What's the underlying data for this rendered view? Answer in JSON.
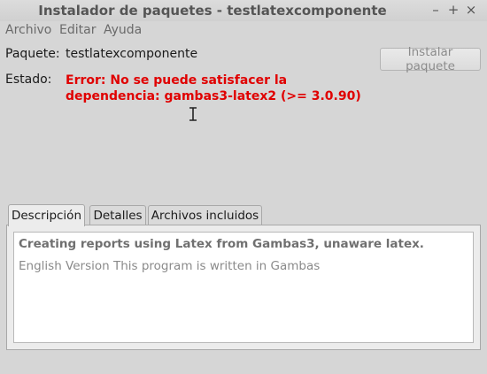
{
  "window": {
    "title": "Instalador de paquetes - testlatexcomponente",
    "controls": {
      "minimize": "–",
      "maximize": "+",
      "close": "×"
    }
  },
  "menu": {
    "items": [
      "Archivo",
      "Editar",
      "Ayuda"
    ]
  },
  "package": {
    "label": "Paquete:",
    "name": "testlatexcomponente"
  },
  "status": {
    "label": "Estado:",
    "line1": "Error: No se puede satisfacer la",
    "line2": "dependencia: gambas3-latex2 (>= 3.0.90)",
    "color": "#e00000"
  },
  "install_button": {
    "label": "Instalar paquete",
    "enabled": false
  },
  "tabs": [
    {
      "label": "Descripción",
      "active": true
    },
    {
      "label": "Detalles",
      "active": false
    },
    {
      "label": "Archivos incluidos",
      "active": false
    }
  ],
  "description": {
    "summary": "Creating reports using Latex from Gambas3, unaware latex.",
    "body": "English Version This program is written in Gambas"
  },
  "icons": {
    "cursor": "text-cursor-icon"
  }
}
